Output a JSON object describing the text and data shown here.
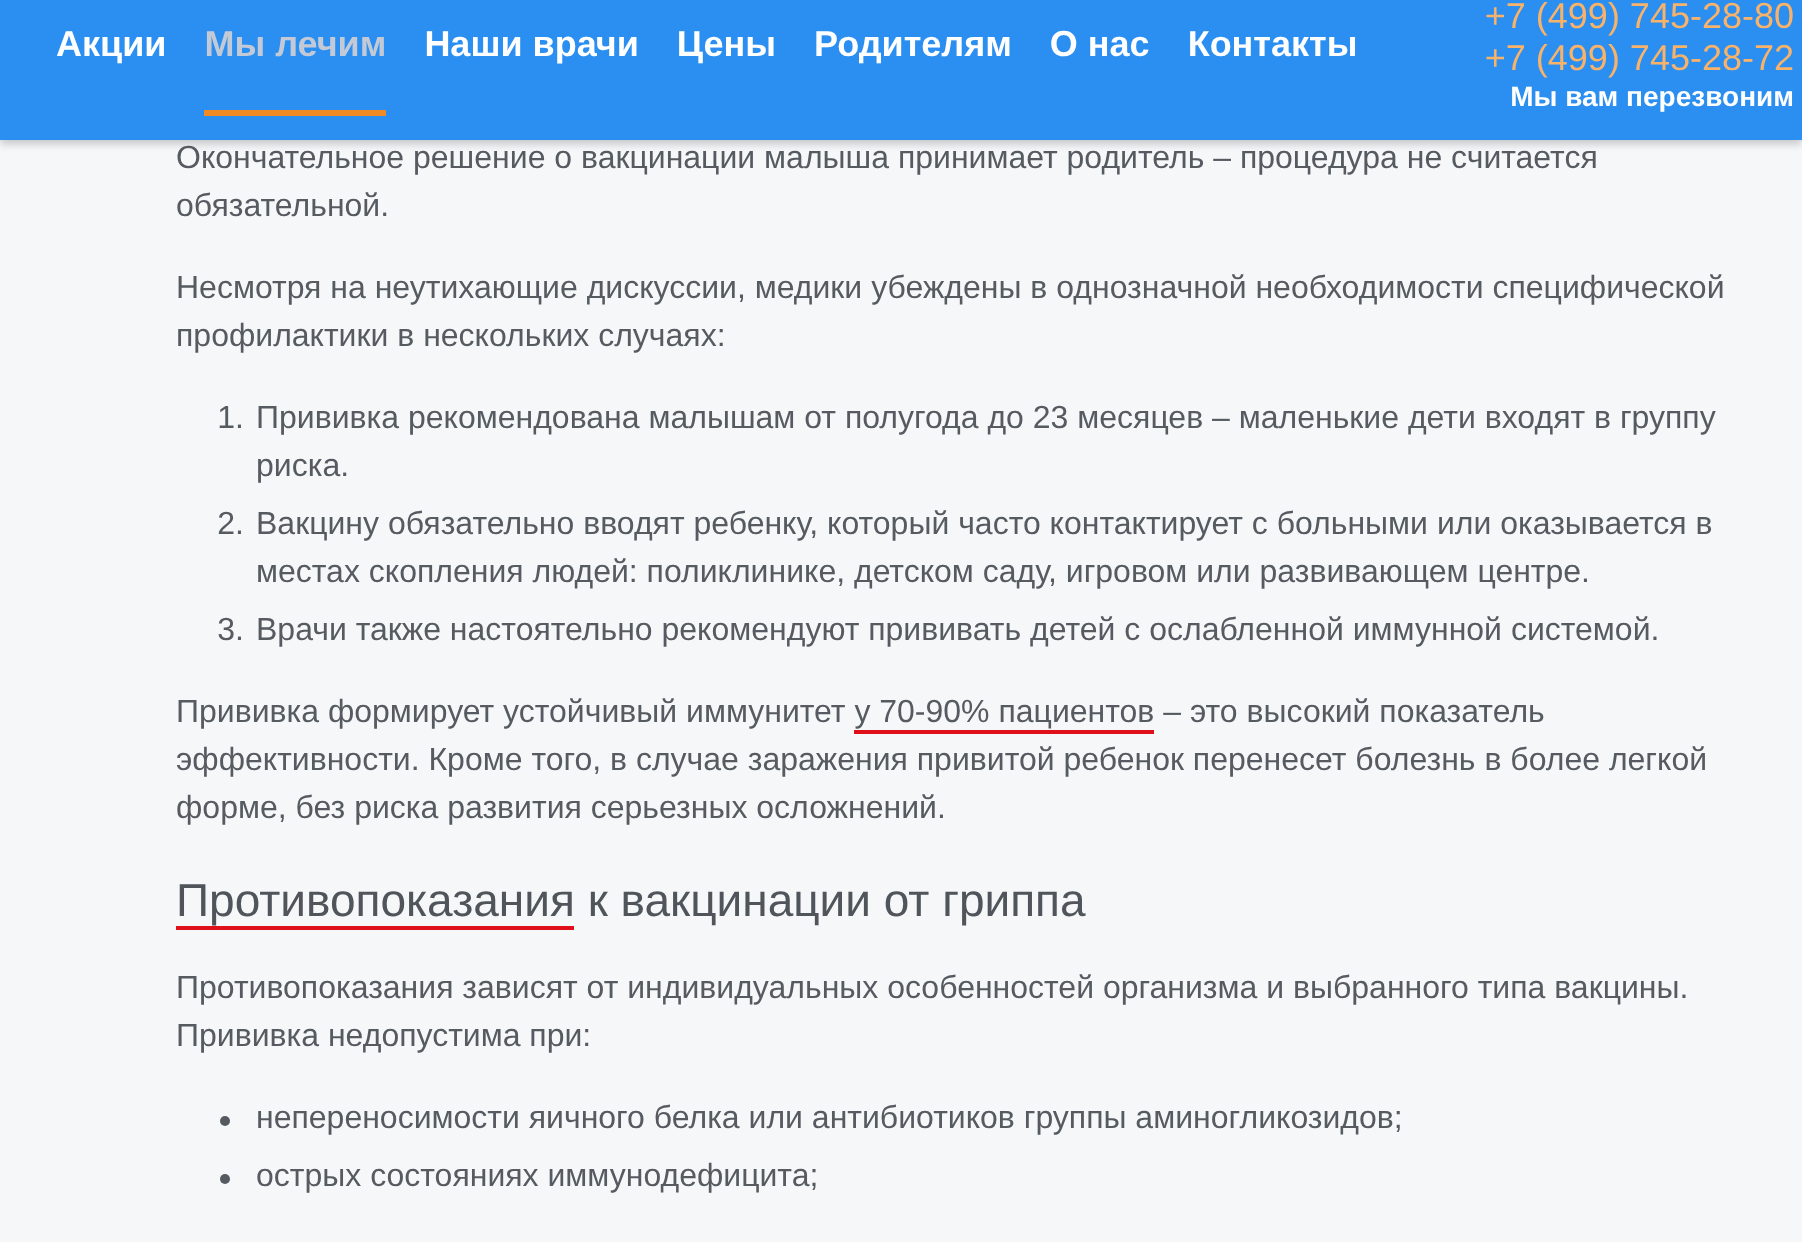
{
  "header": {
    "nav": [
      {
        "label": "Акции",
        "selected": false
      },
      {
        "label": "Мы лечим",
        "selected": true
      },
      {
        "label": "Наши врачи",
        "selected": false
      },
      {
        "label": "Цены",
        "selected": false
      },
      {
        "label": "Родителям",
        "selected": false
      },
      {
        "label": "О нас",
        "selected": false
      },
      {
        "label": "Контакты",
        "selected": false
      }
    ],
    "phones": [
      "+7 (499) 745-28-80",
      "+7 (499) 745-28-72"
    ],
    "callback": "Мы вам перезвоним"
  },
  "content": [
    {
      "kind": "paragraph",
      "parts": [
        {
          "text": "Окончательное решение о вакцинации малыша принимает родитель – процедура не считается обязательной.",
          "underlined": false
        }
      ]
    },
    {
      "kind": "paragraph",
      "parts": [
        {
          "text": "Несмотря на неутихающие дискуссии, медики убеждены в однозначной необходимости специфической профилактики в нескольких случаях:",
          "underlined": false
        }
      ]
    },
    {
      "kind": "ordered_list",
      "items": [
        {
          "number": "1.",
          "text": "Прививка рекомендована малышам от полугода до 23 месяцев – маленькие дети входят в группу риска."
        },
        {
          "number": "2.",
          "text": "Вакцину обязательно вводят ребенку, который часто контактирует с больными или оказывается в местах скопления людей: поликлинике, детском саду, игровом или развивающем центре."
        },
        {
          "number": "3.",
          "text": "Врачи также настоятельно рекомендуют прививать детей с ослабленной иммунной системой."
        }
      ]
    },
    {
      "kind": "paragraph",
      "parts": [
        {
          "text": "Прививка формирует устойчивый иммунитет ",
          "underlined": false
        },
        {
          "text": "у 70-90% пациентов",
          "underlined": true
        },
        {
          "text": " – это высокий показатель эффективности. Кроме того, в случае заражения привитой ребенок перенесет болезнь в более легкой форме, без риска развития серьезных осложнений.",
          "underlined": false
        }
      ]
    },
    {
      "kind": "heading",
      "parts": [
        {
          "text": "Противопоказания",
          "underlined": true
        },
        {
          "text": " к вакцинации от гриппа",
          "underlined": false
        }
      ]
    },
    {
      "kind": "paragraph",
      "parts": [
        {
          "text": "Противопоказания зависят от индивидуальных особенностей организма и выбранного типа вакцины. Прививка недопустима при:",
          "underlined": false
        }
      ]
    },
    {
      "kind": "bullet_list",
      "items": [
        {
          "text": "непереносимости яичного белка или антибиотиков группы аминогликозидов;"
        },
        {
          "text": "острых состояниях иммунодефицита;"
        }
      ]
    }
  ]
}
